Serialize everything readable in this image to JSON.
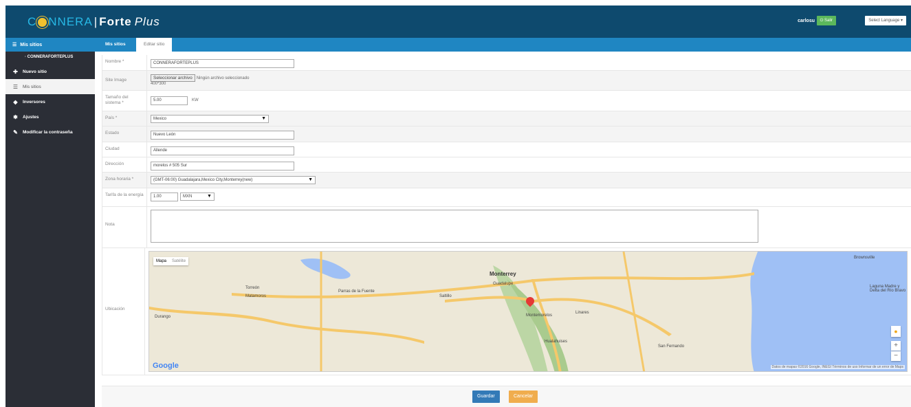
{
  "header": {
    "logo_part1": "C",
    "logo_part2": "NNERA",
    "logo_brand": "Forte",
    "logo_plus": "Plus",
    "user": "carlosu",
    "exit_label": "Salir",
    "language_label": "Select Language"
  },
  "sidebar": {
    "header": "Mis sitios",
    "site_name": "CONNERAFORTEPLUS",
    "items": [
      {
        "label": "Nuevo sitio",
        "icon": "plus-icon"
      },
      {
        "label": "Mis sitios",
        "icon": "list-icon"
      },
      {
        "label": "Inversores",
        "icon": "car-icon"
      },
      {
        "label": "Ajustes",
        "icon": "gear-icon"
      },
      {
        "label": "Modificar la contraseña",
        "icon": "edit-icon"
      }
    ]
  },
  "tabs": {
    "mis_sitios": "Mis sitios",
    "editar_sitio": "Editar sitio"
  },
  "form": {
    "nombre_label": "Nombre *",
    "nombre_value": "CONNERAFORTEPLUS",
    "image_label": "Site Image",
    "file_button": "Seleccionar archivo",
    "file_status": "Ningún archivo seleccionado",
    "image_size": "400*300",
    "tamano_label": "Tamaño del sistema *",
    "tamano_value": "5.00",
    "tamano_unit": "KW",
    "pais_label": "País *",
    "pais_value": "Mexico",
    "estado_label": "Estado",
    "estado_value": "Nuevo León",
    "ciudad_label": "Ciudad",
    "ciudad_value": "Allende",
    "direccion_label": "Dirección",
    "direccion_value": "morelos # 505 Sur",
    "zona_label": "Zona horaria *",
    "zona_value": "(GMT-06:00) Guadalajara,Mexico City,Monterrey(new)",
    "tarifa_label": "Tarifa de la energía",
    "tarifa_value": "1.00",
    "moneda_value": "MXN",
    "nota_label": "Nota",
    "ubicacion_label": "Ubicación"
  },
  "map": {
    "type_map": "Mapa",
    "type_sat": "Satélite",
    "google": "Google",
    "footer_text": "Datos de mapas ©2016 Google, INEGI   Términos de uso   Informar de un error de Maps",
    "labels": [
      {
        "text": "Monterrey",
        "big": true
      },
      {
        "text": "Guadalupe",
        "big": false
      },
      {
        "text": "Montemorelos",
        "big": false
      },
      {
        "text": "Saltillo",
        "big": false
      },
      {
        "text": "Torreón",
        "big": false
      },
      {
        "text": "Matamoros",
        "big": false
      },
      {
        "text": "Brownsville",
        "big": false
      },
      {
        "text": "Laguna Madre y Delta del Río Bravo",
        "big": false
      },
      {
        "text": "Linares",
        "big": false
      },
      {
        "text": "Durango",
        "big": false
      },
      {
        "text": "Parras de la Fuente",
        "big": false
      },
      {
        "text": "San Fernando",
        "big": false
      },
      {
        "text": "Hualahuises",
        "big": false
      }
    ]
  },
  "actions": {
    "save": "Guardar",
    "cancel": "Cancelar"
  }
}
